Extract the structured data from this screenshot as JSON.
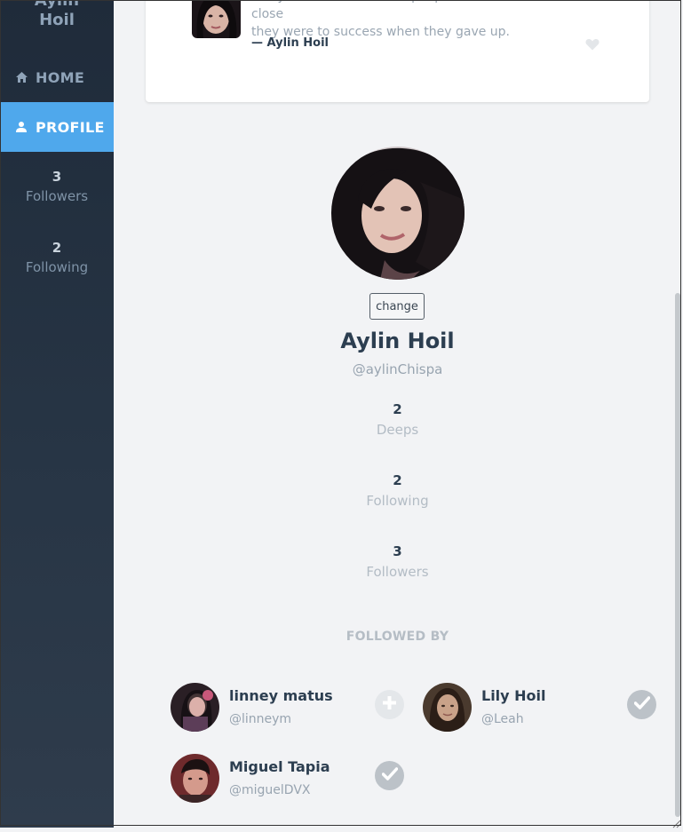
{
  "sidebar": {
    "user_name_partial": "Aylin",
    "user_name_line2": "Hoil",
    "nav": [
      {
        "label": "HOME",
        "icon": "home-icon"
      },
      {
        "label": "PROFILE",
        "icon": "user-icon"
      }
    ],
    "followers": {
      "count": "3",
      "label": "Followers"
    },
    "following": {
      "count": "2",
      "label": "Following"
    }
  },
  "post": {
    "text_line1": "Many of life's failures are people who did not realize how close",
    "text_line2": "they were to success when they gave up.",
    "author": "— Aylin Hoil",
    "icon": "heart-icon"
  },
  "profile": {
    "change_label": "change",
    "name": "Aylin Hoil",
    "handle": "@aylinChispa",
    "stats": [
      {
        "count": "2",
        "label": "Deeps"
      },
      {
        "count": "2",
        "label": "Following"
      },
      {
        "count": "3",
        "label": "Followers"
      }
    ],
    "followed_by_title": "FOLLOWED BY"
  },
  "followed_by": [
    {
      "name": "linney matus",
      "handle": "@linneym",
      "action": "plus-icon"
    },
    {
      "name": "Lily Hoil",
      "handle": "@Leah",
      "action": "check-icon"
    },
    {
      "name": "Miguel Tapia",
      "handle": "@miguelDVX",
      "action": "check-icon"
    }
  ],
  "colors": {
    "sidebar_bg": "#1f2b3a",
    "accent": "#4fa8ec",
    "page_bg": "#f2f3f5",
    "text_dark": "#2c3e50",
    "text_muted": "#98a4b0"
  }
}
